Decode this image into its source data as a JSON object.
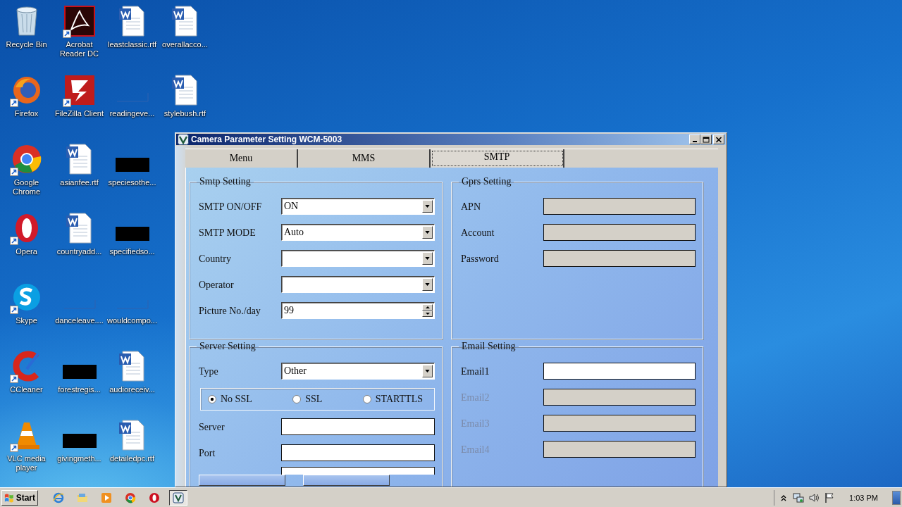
{
  "desktop_icons": [
    {
      "label": "Recycle Bin",
      "kind": "bin",
      "shortcut": false
    },
    {
      "label": "Firefox",
      "kind": "firefox",
      "shortcut": true
    },
    {
      "label": "Google Chrome",
      "kind": "chrome",
      "shortcut": true
    },
    {
      "label": "Opera",
      "kind": "opera",
      "shortcut": true
    },
    {
      "label": "Skype",
      "kind": "skype",
      "shortcut": true
    },
    {
      "label": "CCleaner",
      "kind": "ccleaner",
      "shortcut": true
    },
    {
      "label": "VLC media player",
      "kind": "vlc",
      "shortcut": true
    },
    {
      "label": "Acrobat Reader DC",
      "kind": "pdf",
      "shortcut": true
    },
    {
      "label": "FileZilla Client",
      "kind": "filezilla",
      "shortcut": true
    },
    {
      "label": "asianfee.rtf",
      "kind": "word",
      "shortcut": false
    },
    {
      "label": "countryadd...",
      "kind": "word",
      "shortcut": false
    },
    {
      "label": "danceleave....",
      "kind": "blank",
      "shortcut": false
    },
    {
      "label": "forestregis...",
      "kind": "black",
      "shortcut": false
    },
    {
      "label": "givingmeth...",
      "kind": "black",
      "shortcut": false
    },
    {
      "label": "leastclassic.rtf",
      "kind": "word",
      "shortcut": false
    },
    {
      "label": "readingeve...",
      "kind": "blank",
      "shortcut": false
    },
    {
      "label": "speciesothe...",
      "kind": "black",
      "shortcut": false
    },
    {
      "label": "specifiedso...",
      "kind": "black",
      "shortcut": false
    },
    {
      "label": "wouldcompo...",
      "kind": "blank",
      "shortcut": false
    },
    {
      "label": "audioreceiv...",
      "kind": "word",
      "shortcut": false
    },
    {
      "label": "detailedpc.rtf",
      "kind": "word",
      "shortcut": false
    },
    {
      "label": "overallacco...",
      "kind": "word",
      "shortcut": false
    },
    {
      "label": "stylebush.rtf",
      "kind": "word",
      "shortcut": false
    }
  ],
  "window": {
    "title": "Camera Parameter Setting WCM-5003",
    "tabs": [
      {
        "label": "Menu",
        "selected": false
      },
      {
        "label": "MMS",
        "selected": false
      },
      {
        "label": "SMTP",
        "selected": true
      }
    ],
    "groups": [
      {
        "title": "Smtp Setting",
        "fields": [
          {
            "label": "SMTP ON/OFF",
            "kind": "dropdown",
            "value": "ON"
          },
          {
            "label": "SMTP MODE",
            "kind": "dropdown",
            "value": "Auto"
          },
          {
            "label": "Country",
            "kind": "dropdown"
          },
          {
            "label": "Operator",
            "kind": "dropdown"
          },
          {
            "label": "Picture No./day",
            "kind": "spinner",
            "value": "99"
          }
        ]
      },
      {
        "title": "Gprs Setting",
        "fields": [
          {
            "label": "APN",
            "kind": "text",
            "readonly": true
          },
          {
            "label": "Account",
            "kind": "text",
            "readonly": true
          },
          {
            "label": "Password",
            "kind": "text",
            "readonly": true
          }
        ]
      },
      {
        "title": "Server Setting",
        "fields": [
          {
            "label": "Type",
            "kind": "dropdown",
            "value": "Other"
          },
          {
            "kind": "radios",
            "options": [
              {
                "label": "No SSL",
                "selected": true
              },
              {
                "label": "SSL",
                "selected": false
              },
              {
                "label": "STARTTLS",
                "selected": false
              }
            ]
          },
          {
            "label": "Server",
            "kind": "text"
          },
          {
            "label": "Port",
            "kind": "text"
          },
          {
            "kind": "text"
          }
        ]
      },
      {
        "title": "Email Setting",
        "fields": [
          {
            "label": "Email1",
            "kind": "text",
            "disabled": false
          },
          {
            "label": "Email2",
            "kind": "text",
            "disabled": true
          },
          {
            "label": "Email3",
            "kind": "text",
            "disabled": true
          },
          {
            "label": "Email4",
            "kind": "text",
            "disabled": true
          }
        ]
      }
    ]
  },
  "taskbar": {
    "start": "Start",
    "apps": [
      {
        "kind": "ie",
        "selected": false
      },
      {
        "kind": "folder",
        "selected": false
      },
      {
        "kind": "media",
        "selected": false
      },
      {
        "kind": "chrome",
        "selected": false
      },
      {
        "kind": "opera",
        "selected": false
      },
      {
        "kind": "camera",
        "selected": true
      }
    ],
    "time": "1:03 PM"
  }
}
